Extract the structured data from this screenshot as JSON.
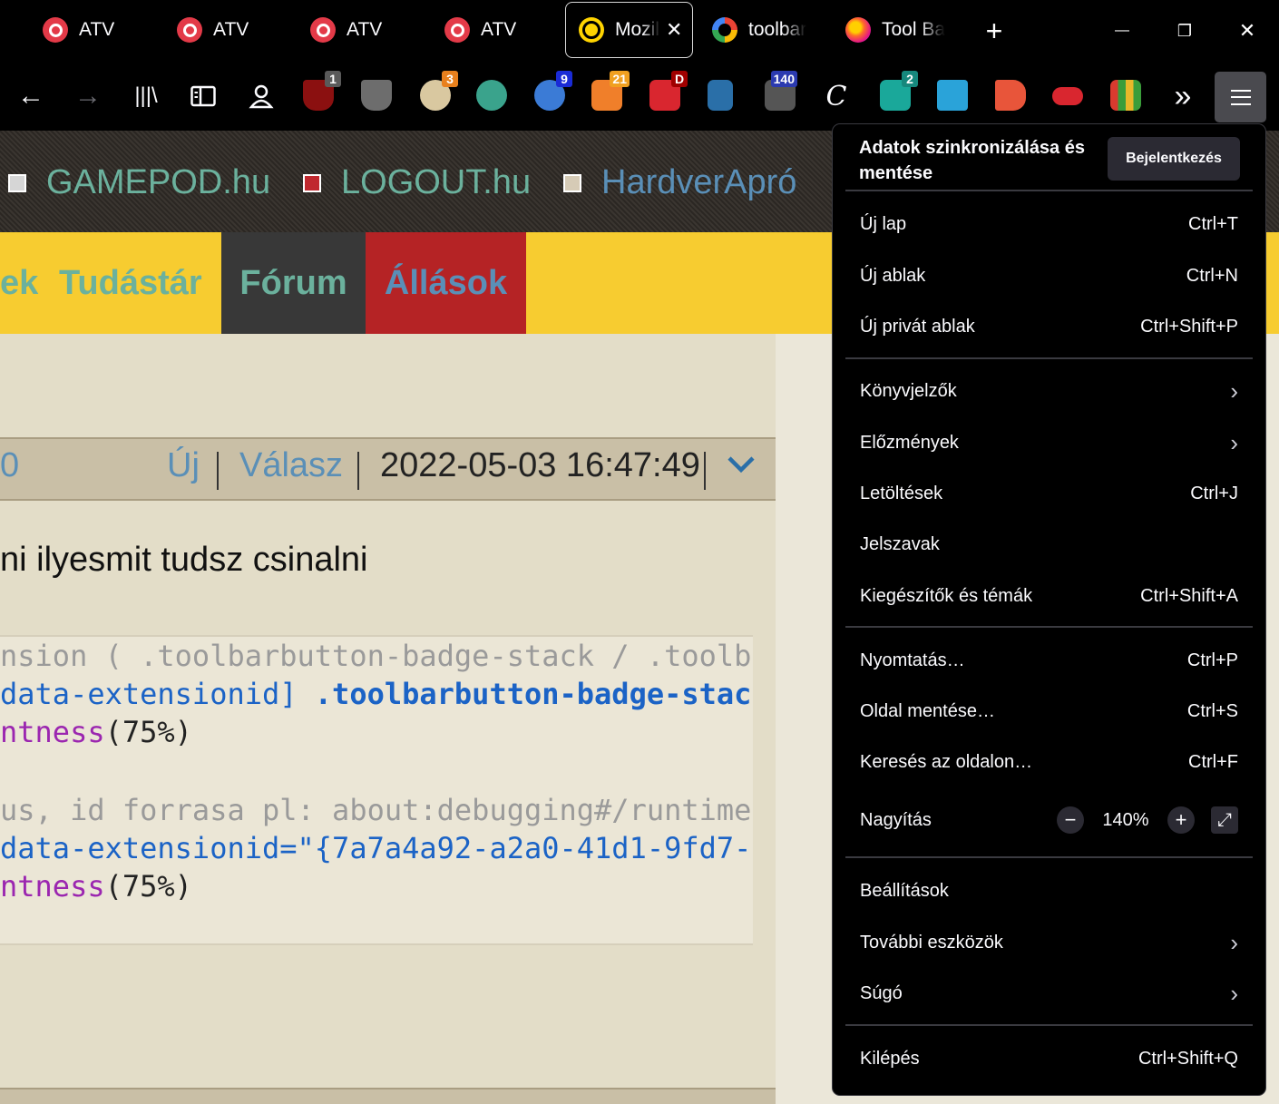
{
  "tabs": [
    {
      "label": "ATV",
      "favicon": "atv-icon"
    },
    {
      "label": "ATV",
      "favicon": "atv-icon"
    },
    {
      "label": "ATV",
      "favicon": "atv-icon"
    },
    {
      "label": "ATV",
      "favicon": "atv-icon"
    },
    {
      "label": "Mozil",
      "favicon": "mozilla-icon",
      "active": true
    },
    {
      "label": "toolbar",
      "favicon": "google-icon"
    },
    {
      "label": "Tool Ba",
      "favicon": "firefox-icon"
    }
  ],
  "tabbar": {
    "new_tab": "+",
    "minimize": "—",
    "restore": "❐",
    "close": "✕"
  },
  "toolbar": {
    "back": "←",
    "forward": "→",
    "overflow": "»",
    "badges": {
      "ublock": "1",
      "honey": "3",
      "ext_9": "9",
      "ext_21": "21",
      "ext_d": "D",
      "ext_140": "140",
      "stylus": "2"
    }
  },
  "site_links": [
    {
      "label": "GAMEPOD.hu",
      "color": "#6bb19d"
    },
    {
      "label": "LOGOUT.hu",
      "color": "#6bb19d"
    },
    {
      "label": "HardverApró",
      "color": "#5a8fb7"
    }
  ],
  "main_nav": [
    {
      "label": "ek"
    },
    {
      "label": "Tudástár"
    },
    {
      "label": "Fórum"
    },
    {
      "label": "Állások"
    }
  ],
  "post": {
    "num": "0",
    "new": "Új",
    "reply": "Válasz",
    "timestamp": "2022-05-03 16:47:49",
    "text": "ni ilyesmit tudsz csinalni"
  },
  "code": {
    "l1": "nsion ( .toolbarbutton-badge-stack / .toolba",
    "l2a": "data-extensionid]",
    "l2b": ".toolbarbutton-badge-stack",
    "l3a": "ntness",
    "l3b": "(75%)",
    "l5": "us, id forrasa pl: about:debugging#/runtime",
    "l6": "data-extensionid=\"{7a7a4a92-a2a0-41d1-9fd7-",
    "l7a": "ntness",
    "l7b": "(75%)"
  },
  "menu": {
    "sync_title": "Adatok szinkronizálása és mentése",
    "signin": "Bejelentkezés",
    "items": [
      {
        "label": "Új lap",
        "shortcut": "Ctrl+T"
      },
      {
        "label": "Új ablak",
        "shortcut": "Ctrl+N"
      },
      {
        "label": "Új privát ablak",
        "shortcut": "Ctrl+Shift+P"
      },
      {
        "label": "Könyvjelzők",
        "shortcut": ""
      },
      {
        "label": "Előzmények",
        "shortcut": ""
      },
      {
        "label": "Letöltések",
        "shortcut": "Ctrl+J"
      },
      {
        "label": "Jelszavak",
        "shortcut": ""
      },
      {
        "label": "Kiegészítők és témák",
        "shortcut": "Ctrl+Shift+A"
      },
      {
        "label": "Nyomtatás…",
        "shortcut": "Ctrl+P"
      },
      {
        "label": "Oldal mentése…",
        "shortcut": "Ctrl+S"
      },
      {
        "label": "Keresés az oldalon…",
        "shortcut": "Ctrl+F"
      },
      {
        "label": "Nagyítás",
        "shortcut": ""
      },
      {
        "label": "Beállítások",
        "shortcut": ""
      },
      {
        "label": "További eszközök",
        "shortcut": ""
      },
      {
        "label": "Súgó",
        "shortcut": ""
      },
      {
        "label": "Kilépés",
        "shortcut": "Ctrl+Shift+Q"
      }
    ],
    "zoom": {
      "minus": "−",
      "value": "140%",
      "plus": "+",
      "fullscreen": "⤢"
    },
    "chevron": "›"
  }
}
